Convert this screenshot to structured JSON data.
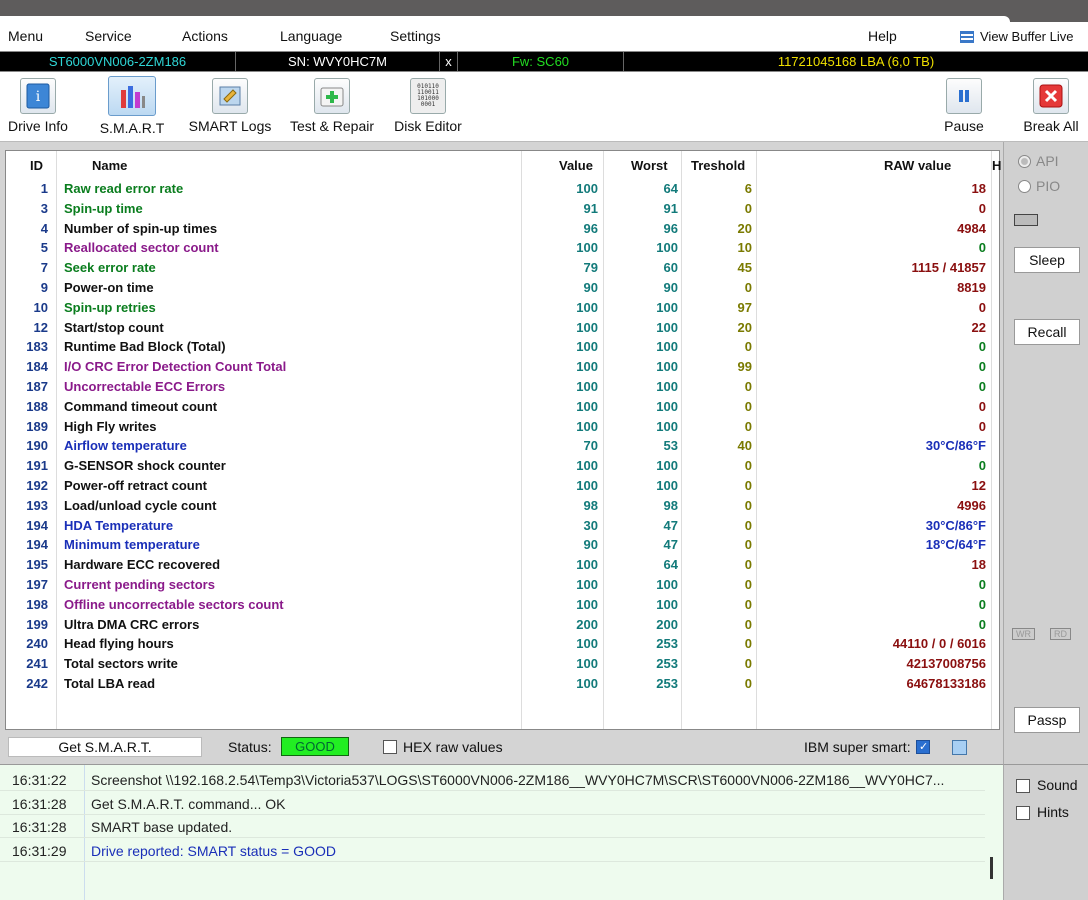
{
  "menu": {
    "items": [
      "Menu",
      "Service",
      "Actions",
      "Language",
      "Settings",
      "Help"
    ],
    "view_buffer": "View Buffer Live"
  },
  "infobar": {
    "model": "ST6000VN006-2ZM186",
    "serial": "SN: WVY0HC7M",
    "close": "x",
    "firmware": "Fw: SC60",
    "lba": "11721045168 LBA (6,0 TB)"
  },
  "toolbar": {
    "drive_info": "Drive Info",
    "smart": "S.M.A.R.T",
    "smart_logs": "SMART Logs",
    "test_repair": "Test & Repair",
    "disk_editor": "Disk Editor",
    "pause": "Pause",
    "break_all": "Break All",
    "disk_editor_icon_text": "010110\n110011\n101000\n0001"
  },
  "table": {
    "headers": {
      "id": "ID",
      "name": "Name",
      "value": "Value",
      "worst": "Worst",
      "threshold": "Treshold",
      "raw": "RAW value",
      "extra": "H"
    },
    "colors": {
      "green": "#0a7d1e",
      "purple": "#8a1a8a",
      "blue": "#1a2fb8",
      "black": "#111111",
      "raw_red": "#8a0f0f",
      "raw_green": "#0a7d1e",
      "raw_blue": "#1a2fb8"
    },
    "rows": [
      {
        "id": "1",
        "name": "Raw read error rate",
        "value": "100",
        "worst": "64",
        "thr": "6",
        "raw": "18",
        "nc": "green",
        "rc": "raw_red"
      },
      {
        "id": "3",
        "name": "Spin-up time",
        "value": "91",
        "worst": "91",
        "thr": "0",
        "raw": "0",
        "nc": "green",
        "rc": "raw_red"
      },
      {
        "id": "4",
        "name": "Number of spin-up times",
        "value": "96",
        "worst": "96",
        "thr": "20",
        "raw": "4984",
        "nc": "black",
        "rc": "raw_red"
      },
      {
        "id": "5",
        "name": "Reallocated sector count",
        "value": "100",
        "worst": "100",
        "thr": "10",
        "raw": "0",
        "nc": "purple",
        "rc": "raw_green"
      },
      {
        "id": "7",
        "name": "Seek error rate",
        "value": "79",
        "worst": "60",
        "thr": "45",
        "raw": "1115 / 41857",
        "nc": "green",
        "rc": "raw_red"
      },
      {
        "id": "9",
        "name": "Power-on time",
        "value": "90",
        "worst": "90",
        "thr": "0",
        "raw": "8819",
        "nc": "black",
        "rc": "raw_red"
      },
      {
        "id": "10",
        "name": "Spin-up retries",
        "value": "100",
        "worst": "100",
        "thr": "97",
        "raw": "0",
        "nc": "green",
        "rc": "raw_red"
      },
      {
        "id": "12",
        "name": "Start/stop count",
        "value": "100",
        "worst": "100",
        "thr": "20",
        "raw": "22",
        "nc": "black",
        "rc": "raw_red"
      },
      {
        "id": "183",
        "name": "Runtime Bad Block (Total)",
        "value": "100",
        "worst": "100",
        "thr": "0",
        "raw": "0",
        "nc": "black",
        "rc": "raw_green"
      },
      {
        "id": "184",
        "name": "I/O CRC Error Detection Count Total",
        "value": "100",
        "worst": "100",
        "thr": "99",
        "raw": "0",
        "nc": "purple",
        "rc": "raw_green"
      },
      {
        "id": "187",
        "name": "Uncorrectable ECC Errors",
        "value": "100",
        "worst": "100",
        "thr": "0",
        "raw": "0",
        "nc": "purple",
        "rc": "raw_green"
      },
      {
        "id": "188",
        "name": "Command timeout count",
        "value": "100",
        "worst": "100",
        "thr": "0",
        "raw": "0",
        "nc": "black",
        "rc": "raw_red"
      },
      {
        "id": "189",
        "name": "High Fly writes",
        "value": "100",
        "worst": "100",
        "thr": "0",
        "raw": "0",
        "nc": "black",
        "rc": "raw_red"
      },
      {
        "id": "190",
        "name": "Airflow temperature",
        "value": "70",
        "worst": "53",
        "thr": "40",
        "raw": "30°C/86°F",
        "nc": "blue",
        "rc": "raw_blue"
      },
      {
        "id": "191",
        "name": "G-SENSOR shock counter",
        "value": "100",
        "worst": "100",
        "thr": "0",
        "raw": "0",
        "nc": "black",
        "rc": "raw_green"
      },
      {
        "id": "192",
        "name": "Power-off retract count",
        "value": "100",
        "worst": "100",
        "thr": "0",
        "raw": "12",
        "nc": "black",
        "rc": "raw_red"
      },
      {
        "id": "193",
        "name": "Load/unload cycle count",
        "value": "98",
        "worst": "98",
        "thr": "0",
        "raw": "4996",
        "nc": "black",
        "rc": "raw_red"
      },
      {
        "id": "194",
        "name": "HDA Temperature",
        "value": "30",
        "worst": "47",
        "thr": "0",
        "raw": "30°C/86°F",
        "nc": "blue",
        "rc": "raw_blue"
      },
      {
        "id": "194",
        "name": "Minimum temperature",
        "value": "90",
        "worst": "47",
        "thr": "0",
        "raw": "18°C/64°F",
        "nc": "blue",
        "rc": "raw_blue"
      },
      {
        "id": "195",
        "name": "Hardware ECC recovered",
        "value": "100",
        "worst": "64",
        "thr": "0",
        "raw": "18",
        "nc": "black",
        "rc": "raw_red"
      },
      {
        "id": "197",
        "name": "Current pending sectors",
        "value": "100",
        "worst": "100",
        "thr": "0",
        "raw": "0",
        "nc": "purple",
        "rc": "raw_green"
      },
      {
        "id": "198",
        "name": "Offline uncorrectable sectors count",
        "value": "100",
        "worst": "100",
        "thr": "0",
        "raw": "0",
        "nc": "purple",
        "rc": "raw_green"
      },
      {
        "id": "199",
        "name": "Ultra DMA CRC errors",
        "value": "200",
        "worst": "200",
        "thr": "0",
        "raw": "0",
        "nc": "black",
        "rc": "raw_green"
      },
      {
        "id": "240",
        "name": "Head flying hours",
        "value": "100",
        "worst": "253",
        "thr": "0",
        "raw": "44110 / 0 / 6016",
        "nc": "black",
        "rc": "raw_red"
      },
      {
        "id": "241",
        "name": "Total sectors write",
        "value": "100",
        "worst": "253",
        "thr": "0",
        "raw": "42137008756",
        "nc": "black",
        "rc": "raw_red"
      },
      {
        "id": "242",
        "name": "Total LBA read",
        "value": "100",
        "worst": "253",
        "thr": "0",
        "raw": "64678133186",
        "nc": "black",
        "rc": "raw_red"
      }
    ]
  },
  "status": {
    "get_button": "Get S.M.A.R.T.",
    "status_label": "Status:",
    "status_value": "GOOD",
    "hex_label": "HEX raw values",
    "ibm_label": "IBM super smart:"
  },
  "right_panel": {
    "api": "API",
    "pio": "PIO",
    "sleep": "Sleep",
    "recall": "Recall",
    "wr": "WR",
    "rd": "RD",
    "passp": "Passp"
  },
  "log": {
    "entries": [
      {
        "time": "16:31:22",
        "msg": "Screenshot \\\\192.168.2.54\\Temp3\\Victoria537\\LOGS\\ST6000VN006-2ZM186__WVY0HC7M\\SCR\\ST6000VN006-2ZM186__WVY0HC7...",
        "color": "#222222"
      },
      {
        "time": "16:31:28",
        "msg": "Get S.M.A.R.T. command... OK",
        "color": "#222222"
      },
      {
        "time": "16:31:28",
        "msg": "SMART base updated.",
        "color": "#222222"
      },
      {
        "time": "16:31:29",
        "msg": "Drive reported: SMART status = GOOD",
        "color": "#1a2fb8"
      }
    ],
    "sound": "Sound",
    "hints": "Hints"
  }
}
